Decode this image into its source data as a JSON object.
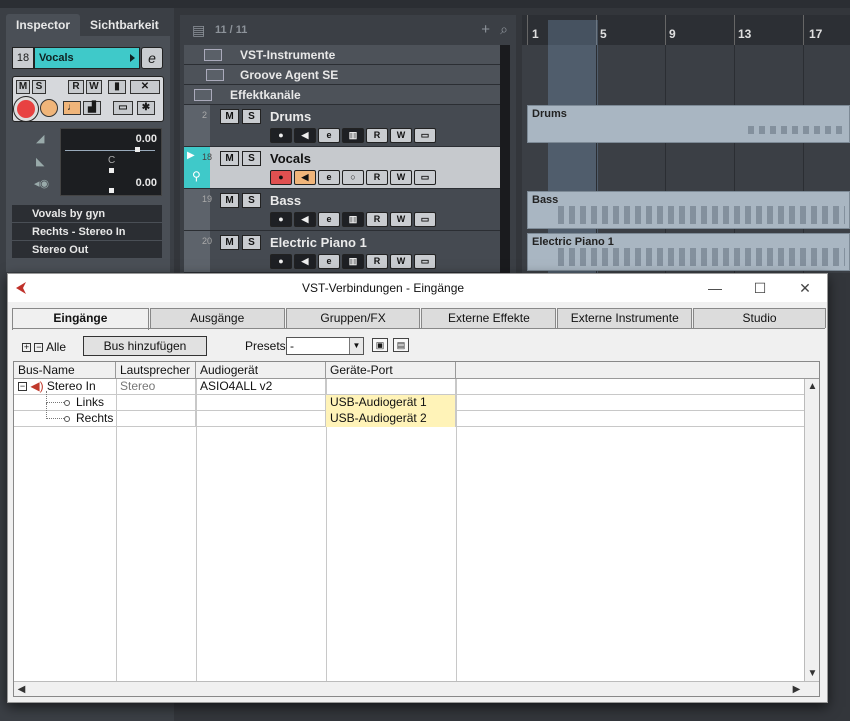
{
  "inspector": {
    "tabs": [
      "Inspector",
      "Sichtbarkeit"
    ],
    "track_number": "18",
    "track_name": "Vocals",
    "edit_label": "e",
    "buttons_row1": [
      "M",
      "S",
      "R",
      "W"
    ],
    "volume_value": "0.00",
    "pan_value": "C",
    "delay_value": "0.00",
    "sections": [
      "Vovals by gyn",
      "Rechts - Stereo In",
      "Stereo Out"
    ],
    "colors": {
      "selected_track": "#3fc9c9",
      "record": "#e84141",
      "monitor": "#f0b57a"
    }
  },
  "tracklist": {
    "count": "11 / 11",
    "folders": [
      "VST-Instrumente",
      "Groove Agent SE",
      "Effektkanäle"
    ],
    "tracks": [
      {
        "num": "2",
        "name": "Drums"
      },
      {
        "num": "18",
        "name": "Vocals"
      },
      {
        "num": "19",
        "name": "Bass"
      },
      {
        "num": "20",
        "name": "Electric Piano 1"
      }
    ],
    "mute_label": "M",
    "solo_label": "S",
    "read_label": "R",
    "write_label": "W",
    "edit_label": "e"
  },
  "arrangement": {
    "ruler": [
      "1",
      "5",
      "9",
      "13",
      "17"
    ],
    "clips": [
      "Drums",
      "Bass",
      "Electric Piano 1"
    ]
  },
  "dialog": {
    "title": "VST-Verbindungen - Eingänge",
    "tabs": [
      "Eingänge",
      "Ausgänge",
      "Gruppen/FX",
      "Externe Effekte",
      "Externe Instrumente",
      "Studio"
    ],
    "expand_all_label": "Alle",
    "add_bus_label": "Bus hinzufügen",
    "presets_label": "Presets",
    "presets_value": "-",
    "columns": [
      "Bus-Name",
      "Lautsprecher",
      "Audiogerät",
      "Geräte-Port"
    ],
    "rows": [
      {
        "bus": "Stereo In",
        "speaker": "Stereo",
        "device": "ASIO4ALL v2",
        "port": ""
      },
      {
        "bus": "Links",
        "speaker": "",
        "device": "",
        "port": "USB-Audiogerät 1"
      },
      {
        "bus": "Rechts",
        "speaker": "",
        "device": "",
        "port": "USB-Audiogerät 2"
      }
    ],
    "controls": {
      "minimize": "—",
      "maximize": "☐",
      "close": "✕"
    }
  }
}
